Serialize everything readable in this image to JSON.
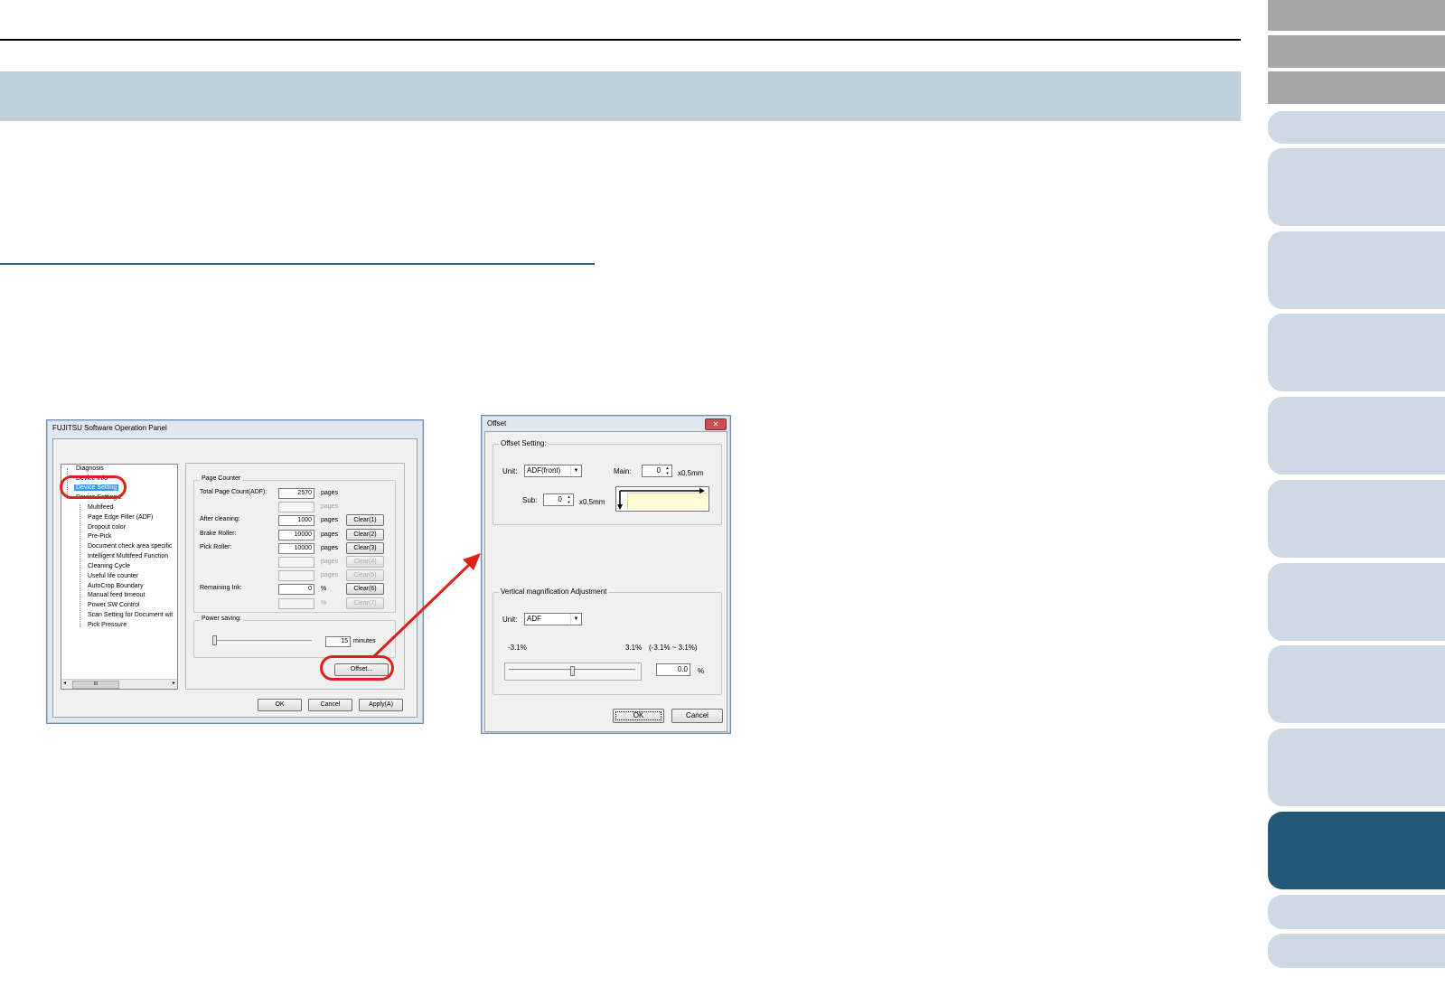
{
  "operation_panel": {
    "title": "FUJITSU Software Operation Panel",
    "tree": [
      "Diagnosis",
      "Device Info",
      "Device Setting",
      "Device Setting 2",
      "Multifeed",
      "Page Edge Filler (ADF)",
      "Dropout color",
      "Pre-Pick",
      "Document check area specific",
      "Intelligent Multifeed Function",
      "Cleaning Cycle",
      "Useful life counter",
      "AutoCrop Boundary",
      "Manual feed timeout",
      "Power SW Control",
      "Scan Setting for Document wit",
      "Pick Pressure"
    ],
    "scroll_thumb_label": "III",
    "page_counter": {
      "label": "Page Counter",
      "rows": [
        {
          "label": "Total Page Count(ADF):",
          "value": "2570",
          "unit": "pages",
          "button": ""
        },
        {
          "label": "",
          "value": "",
          "unit": "pages",
          "button": ""
        },
        {
          "label": "After cleaning:",
          "value": "1000",
          "unit": "pages",
          "button": "Clear(1)"
        },
        {
          "label": "Brake Roller:",
          "value": "10000",
          "unit": "pages",
          "button": "Clear(2)"
        },
        {
          "label": "Pick Roller:",
          "value": "10000",
          "unit": "pages",
          "button": "Clear(3)"
        },
        {
          "label": "",
          "value": "",
          "unit": "pages",
          "button": "Clear(4)"
        },
        {
          "label": "",
          "value": "",
          "unit": "pages",
          "button": "Clear(5)"
        },
        {
          "label": "Remaining Ink:",
          "value": "0",
          "unit": "%",
          "button": "Clear(6)"
        },
        {
          "label": "",
          "value": "",
          "unit": "%",
          "button": "Clear(7)"
        }
      ]
    },
    "power_saving": {
      "label": "Power saving:",
      "value": "15",
      "unit": "minutes"
    },
    "offset_button": "Offset...",
    "buttons": {
      "ok": "OK",
      "cancel": "Cancel",
      "apply": "Apply(A)"
    }
  },
  "offset_dialog": {
    "title": "Offset",
    "close_glyph": "✕",
    "offset_setting": {
      "label": "Offset Setting:",
      "unit_label": "Unit:",
      "unit_value": "ADF(front)",
      "main_label": "Main:",
      "main_value": "0",
      "main_unit": "x0.5mm",
      "sub_label": "Sub:",
      "sub_value": "0",
      "sub_unit": "x0.5mm"
    },
    "vertical": {
      "label": "Vertical magnification Adjustment",
      "unit_label": "Unit:",
      "unit_value": "ADF",
      "min_label": "-3.1%",
      "max_label": "3.1%",
      "range_label": "(-3.1% ~ 3.1%)",
      "value": "0.0",
      "value_unit": "%",
      "slider_fraction": 0.5
    },
    "buttons": {
      "ok": "OK",
      "cancel": "Cancel"
    }
  },
  "colors": {
    "accent_red": "#e0201a",
    "active_tab": "#245878",
    "tab": "#cdd9e3",
    "title_band": "#bfd0da"
  }
}
